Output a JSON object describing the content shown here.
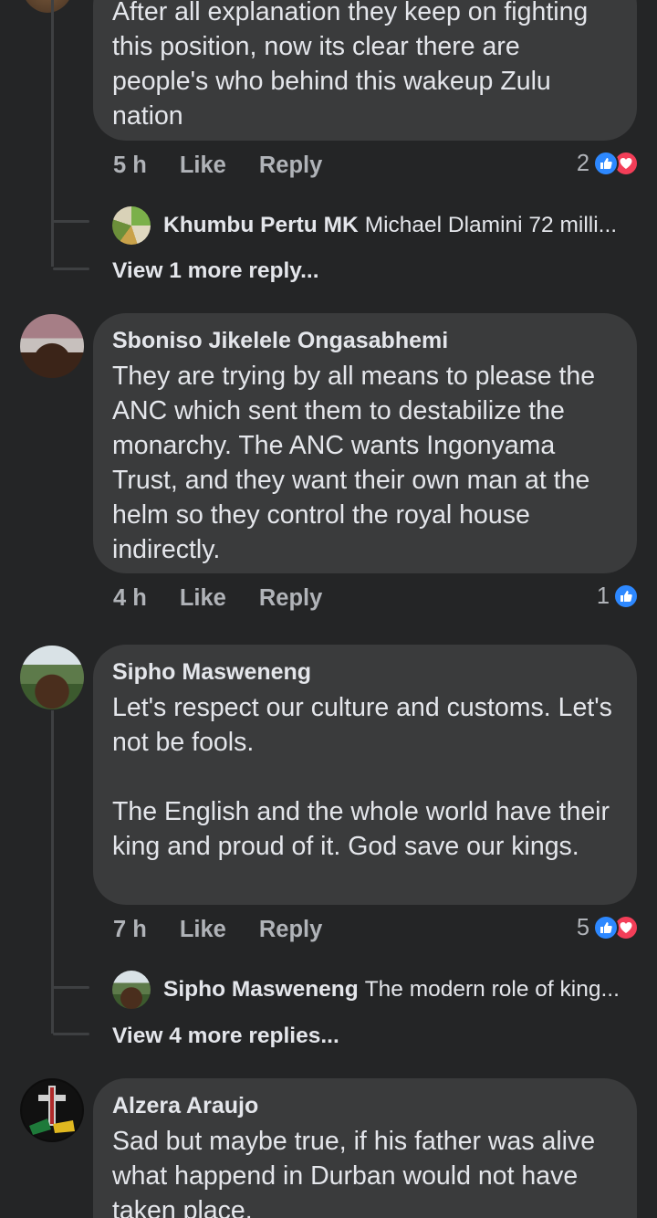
{
  "comments": [
    {
      "author": "",
      "text": "After all explanation they keep on fighting this position, now its clear there are people's who behind this wakeup Zulu nation",
      "time": "5 h",
      "like_label": "Like",
      "reply_label": "Reply",
      "reaction_count": "2",
      "reactions": [
        "like-icon",
        "love-icon"
      ],
      "reply_preview": {
        "name": "Khumbu Pertu MK",
        "text": "Michael Dlamini 72 milli..."
      },
      "more_replies": "View 1 more reply..."
    },
    {
      "author": "Sboniso Jikelele Ongasabhemi",
      "text": "They are trying by all means to please the ANC which sent them to destabilize the monarchy. The ANC wants Ingonyama Trust, and they want their own man at the helm so they control the royal house indirectly.",
      "time": "4 h",
      "like_label": "Like",
      "reply_label": "Reply",
      "reaction_count": "1",
      "reactions": [
        "like-icon"
      ]
    },
    {
      "author": "Sipho Masweneng",
      "text": "Let's respect our culture and customs. Let's not be fools.\n\nThe English and the whole world have their king and proud of it. God save our kings.",
      "time": "7 h",
      "like_label": "Like",
      "reply_label": "Reply",
      "reaction_count": "5",
      "reactions": [
        "like-icon",
        "love-icon"
      ],
      "reply_preview": {
        "name": "Sipho Masweneng",
        "text": "The modern role of king..."
      },
      "more_replies": "View 4 more replies..."
    },
    {
      "author": "Alzera Araujo",
      "text": "Sad but maybe true, if his father was alive what happend in Durban would not have taken place."
    }
  ],
  "colors": {
    "background": "#242526",
    "bubble": "#3a3b3c",
    "text": "#e4e6eb",
    "secondary_text": "#b0b3b8",
    "like_blue": "#2d88ff",
    "love_red": "#f33e58"
  }
}
